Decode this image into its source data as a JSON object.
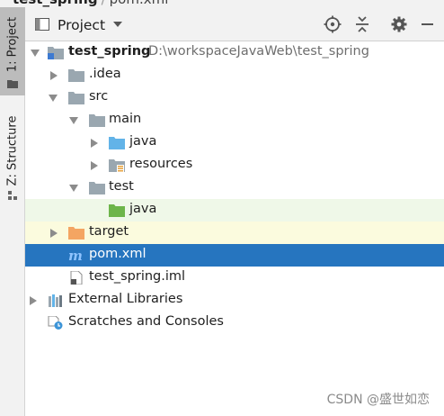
{
  "breadcrumb": {
    "project": "test_spring",
    "separator": "/",
    "file": "pom.xml"
  },
  "side_tabs": [
    {
      "label": "1: Project",
      "active": true
    },
    {
      "label": "Z: Structure",
      "active": false
    }
  ],
  "panel": {
    "title": "Project",
    "buttons": [
      "locate-icon",
      "collapse-all-icon",
      "gear-icon",
      "minimize-icon"
    ]
  },
  "tree": {
    "root": {
      "name": "test_spring",
      "path": "D:\\workspaceJavaWeb\\test_spring"
    },
    "idea": ".idea",
    "src": "src",
    "main": "main",
    "main_java": "java",
    "resources": "resources",
    "test": "test",
    "test_java": "java",
    "target": "target",
    "pom": "pom.xml",
    "iml": "test_spring.iml",
    "external_libraries": "External Libraries",
    "scratches": "Scratches and Consoles"
  },
  "colors": {
    "selection": "#2675bf",
    "folder": "#9aa7b0",
    "source_folder": "#62b3e8",
    "test_folder": "#6db54a",
    "excluded_folder": "#f4a562",
    "maven": "#3d7ad1"
  },
  "watermark": "CSDN @盛世如恋"
}
